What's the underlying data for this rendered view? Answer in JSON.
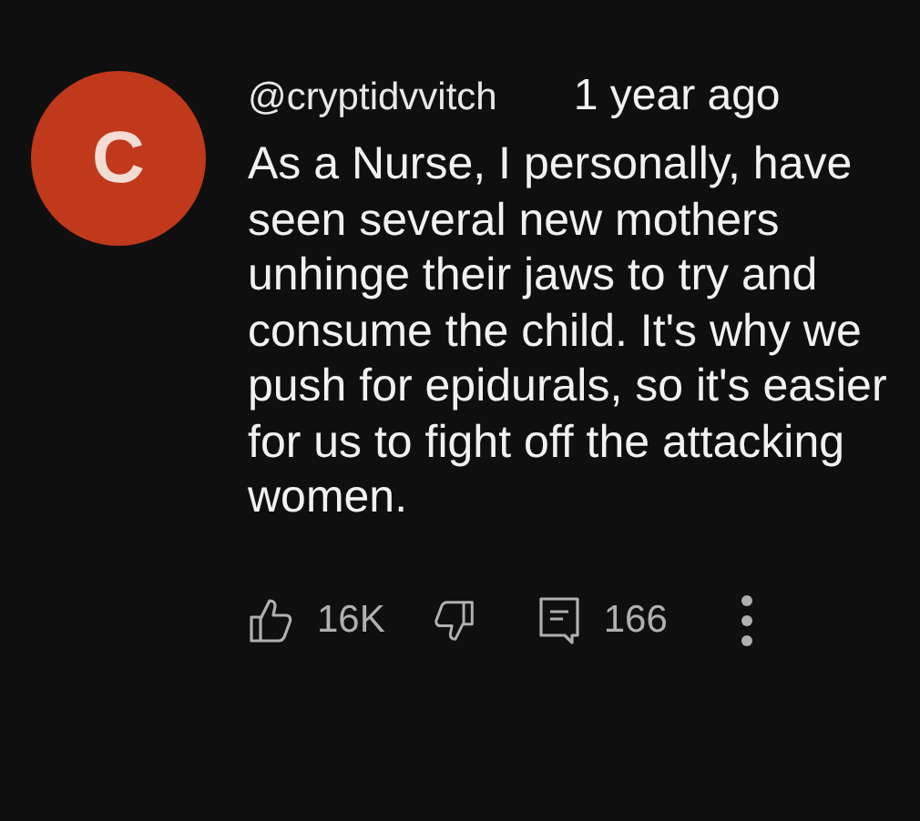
{
  "comment": {
    "author": "@cryptidvvitch",
    "time": "1 year ago",
    "avatar_letter": "C",
    "text": "As a Nurse, I personally, have seen several new mothers unhinge their jaws to try and consume the child. It's why we push for epidurals, so it's easier for us to fight off the attacking women.",
    "likes": "16K",
    "replies": "166"
  }
}
